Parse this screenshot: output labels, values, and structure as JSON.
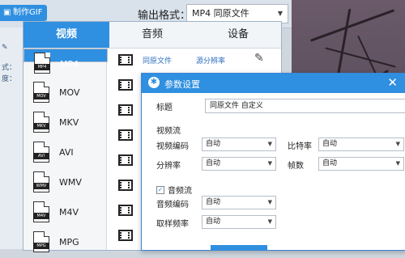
{
  "toolbar": {
    "gif_button": "制作GIF",
    "output_label": "输出格式：",
    "output_value": "MP4 同原文件"
  },
  "left_panel": {
    "fragments": [
      "式：",
      "度："
    ]
  },
  "tabs": [
    {
      "label": "视频",
      "active": true
    },
    {
      "label": "音频",
      "active": false
    },
    {
      "label": "设备",
      "active": false
    }
  ],
  "formats": [
    {
      "label": "MP4",
      "selected": true
    },
    {
      "label": "MOV",
      "selected": false
    },
    {
      "label": "MKV",
      "selected": false
    },
    {
      "label": "AVI",
      "selected": false
    },
    {
      "label": "WMV",
      "selected": false
    },
    {
      "label": "M4V",
      "selected": false
    },
    {
      "label": "MPG",
      "selected": false
    }
  ],
  "presets": [
    {
      "name": "同原文件",
      "desc": "源分辨率"
    }
  ],
  "dialog": {
    "title": "参数设置",
    "title_label": "标题",
    "title_value": "同原文件 自定义",
    "video_section": "视频流",
    "video_codec_label": "视频编码",
    "video_codec_value": "自动",
    "bitrate_label": "比特率",
    "bitrate_value": "自动",
    "resolution_label": "分辨率",
    "resolution_value": "自动",
    "framerate_label": "帧数",
    "framerate_value": "自动",
    "audio_section": "音频流",
    "audio_checked": true,
    "audio_codec_label": "音频编码",
    "audio_codec_value": "自动",
    "sample_rate_label": "取样频率",
    "sample_rate_value": "自动"
  },
  "colors": {
    "accent": "#2f8fe0",
    "link": "#2f6fc0"
  }
}
